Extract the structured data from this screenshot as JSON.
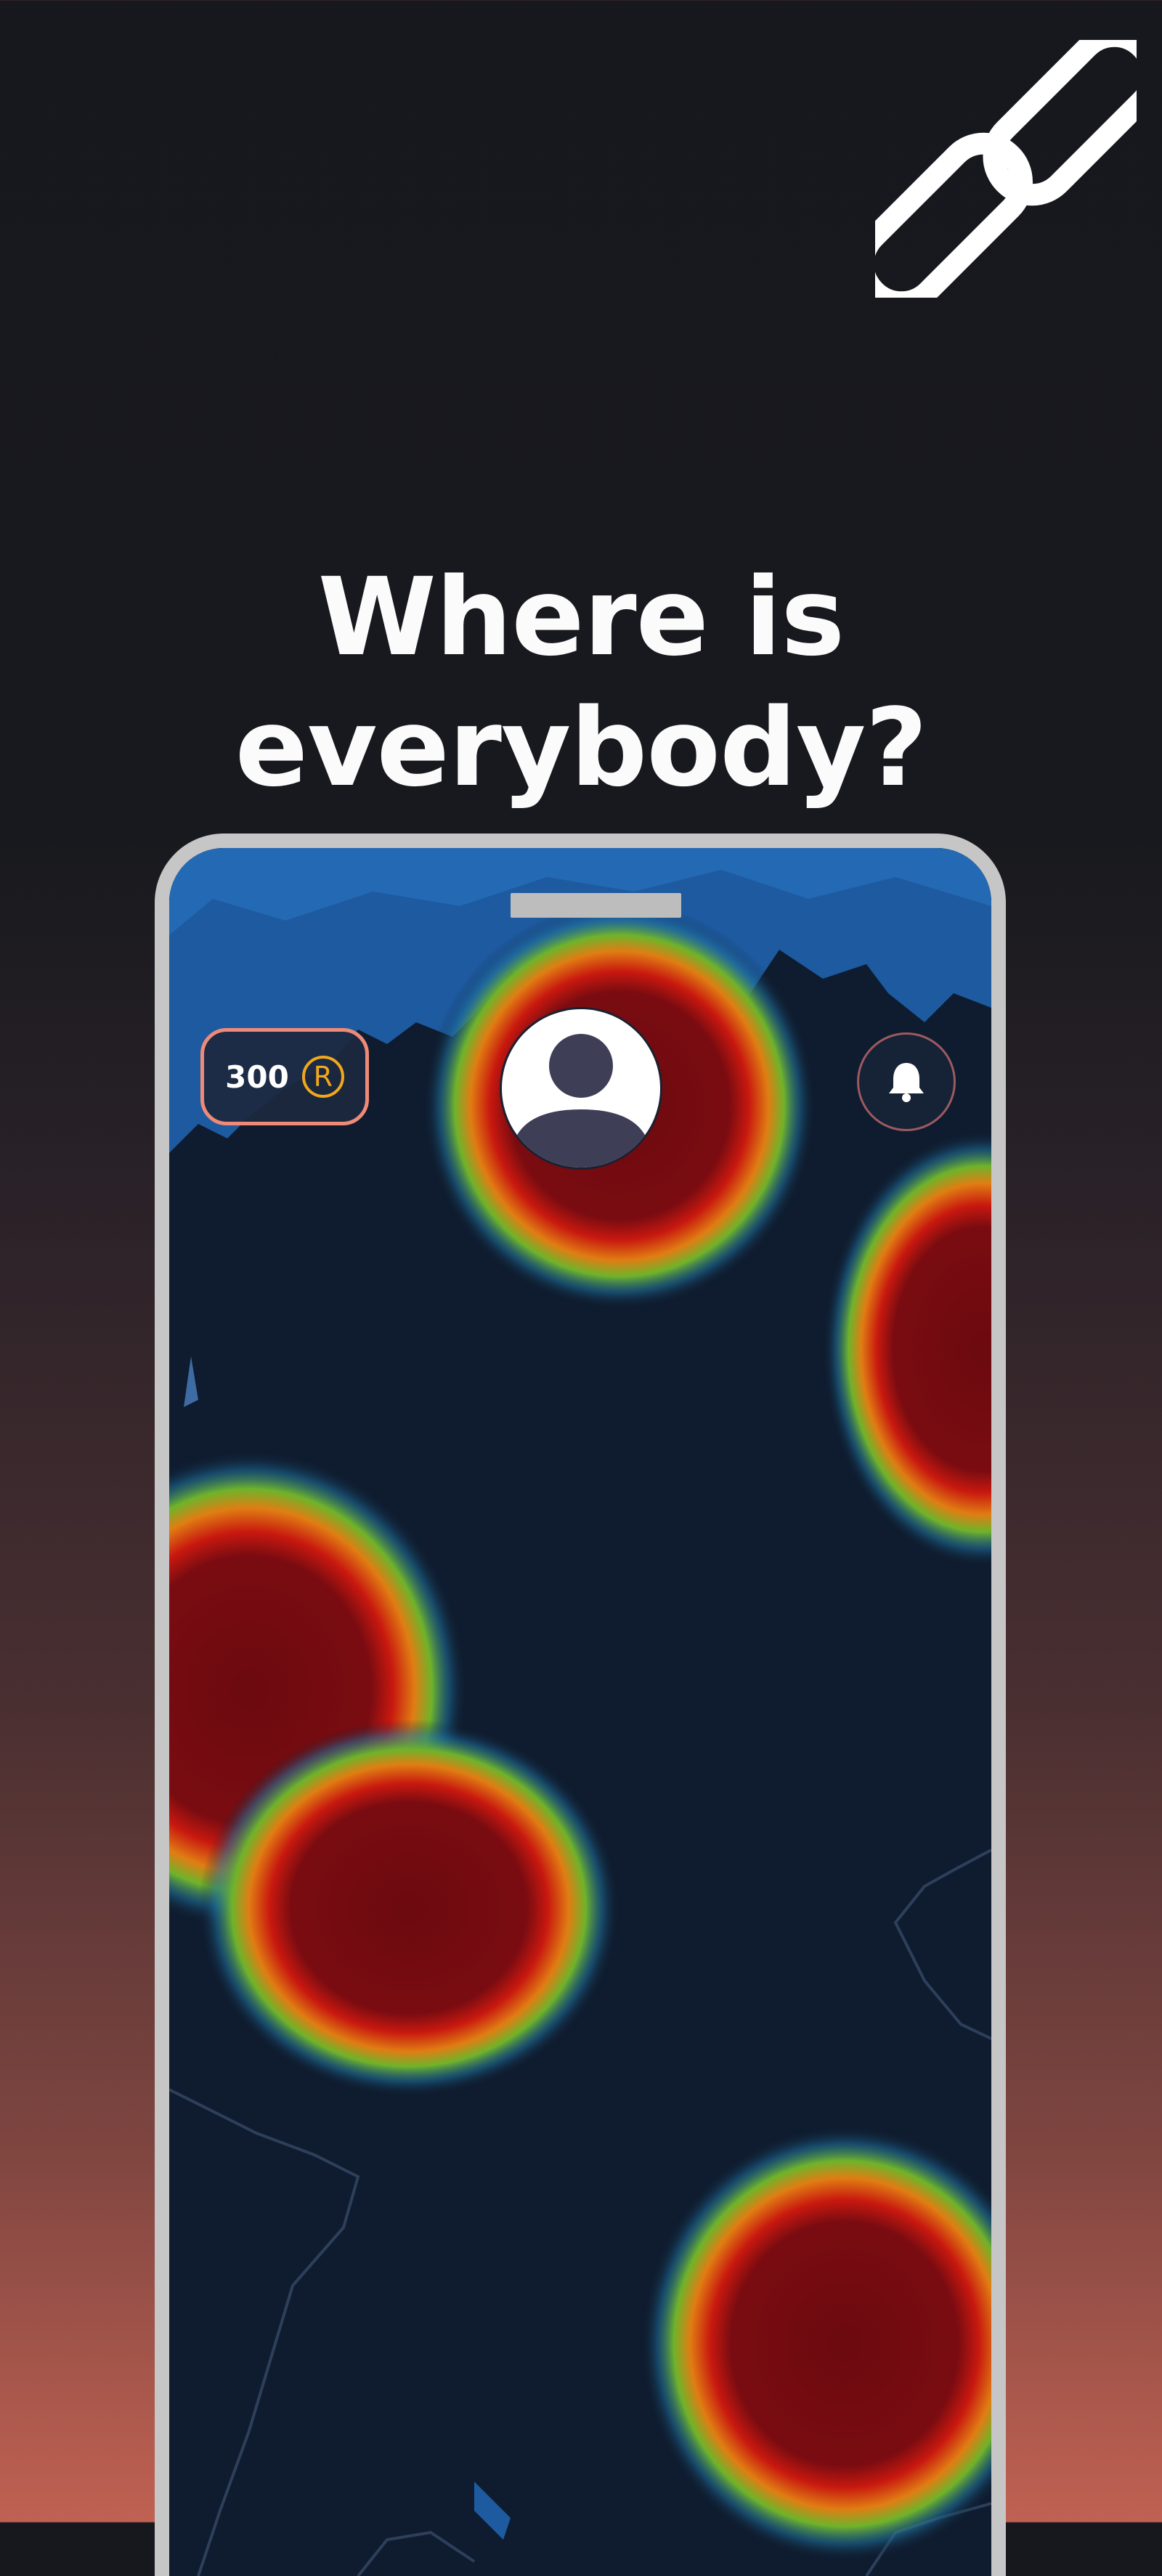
{
  "headline": "Where is everybody?",
  "logo_icon": "link-chain-icon",
  "map": {
    "points_badge": {
      "value": "300",
      "currency_symbol": "R"
    },
    "avatar_icon": "default-user-avatar-icon",
    "notifications_icon": "bell-icon",
    "heatmap_colors": [
      "#6b0a10",
      "#c8180f",
      "#e07d13",
      "#6fb32a",
      "#1e6f9a"
    ]
  },
  "colors": {
    "background_top": "#17181d",
    "background_bottom": "#c06152",
    "accent": "#f08a77",
    "coin": "#f0a81b"
  }
}
